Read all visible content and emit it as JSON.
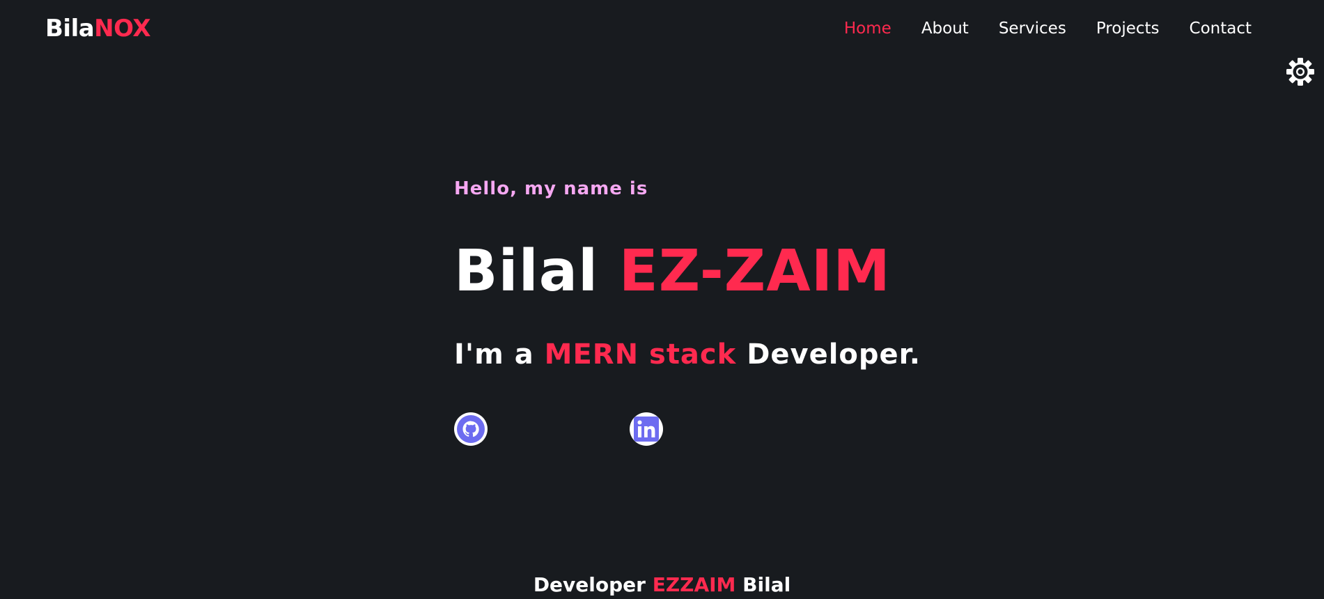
{
  "header": {
    "logo_primary": "Bila",
    "logo_accent": "NOX",
    "nav": [
      {
        "label": "Home",
        "active": true
      },
      {
        "label": "About",
        "active": false
      },
      {
        "label": "Services",
        "active": false
      },
      {
        "label": "Projects",
        "active": false
      },
      {
        "label": "Contact",
        "active": false
      }
    ]
  },
  "hero": {
    "greeting": "Hello, my name is",
    "first_name": "Bilal",
    "last_name": "EZ-ZAIM",
    "role_prefix": "I'm a",
    "role_accent": "MERN stack",
    "role_suffix": "Developer."
  },
  "social": {
    "github_icon": "github-icon",
    "linkedin_icon": "linkedin-icon"
  },
  "footer": {
    "prefix": "Developer",
    "accent": "EZZAIM",
    "suffix": "Bilal"
  },
  "colors": {
    "background": "#181b1f",
    "accent": "#ff2a4f",
    "greeting": "#f6a8f2",
    "icon": "#6d6cf0"
  },
  "settings": {
    "icon": "gear-icon"
  }
}
